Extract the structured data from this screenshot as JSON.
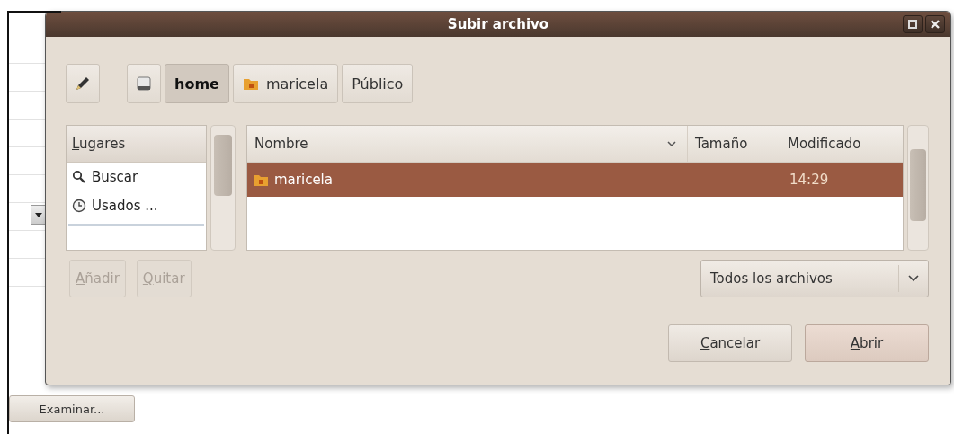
{
  "window": {
    "title": "Subir archivo"
  },
  "path_bar": [
    {
      "kind": "edit",
      "selected": false
    },
    {
      "kind": "drive",
      "selected": false
    },
    {
      "kind": "text",
      "label": "home",
      "selected": true
    },
    {
      "kind": "folder",
      "label": "maricela",
      "selected": false
    },
    {
      "kind": "text",
      "label": "Público",
      "selected": false
    }
  ],
  "places": {
    "header": "Lugares",
    "items": [
      {
        "kind": "search",
        "label": "Buscar"
      },
      {
        "kind": "recent",
        "label": "Usados ..."
      }
    ]
  },
  "places_buttons": [
    {
      "label": "Añadir",
      "disabled": true
    },
    {
      "label": "Quitar",
      "disabled": true
    }
  ],
  "files": {
    "columns": [
      "Nombre",
      "Tamaño",
      "Modificado"
    ],
    "rows": [
      {
        "name": "maricela",
        "modified": "14:29",
        "selected": true
      }
    ]
  },
  "filter": {
    "value": "Todos los archivos"
  },
  "actions": [
    {
      "label": "Cancelar",
      "kind": "cancel"
    },
    {
      "label": "Abrir",
      "kind": "default"
    }
  ],
  "page_button": {
    "label": "Examinar..."
  }
}
